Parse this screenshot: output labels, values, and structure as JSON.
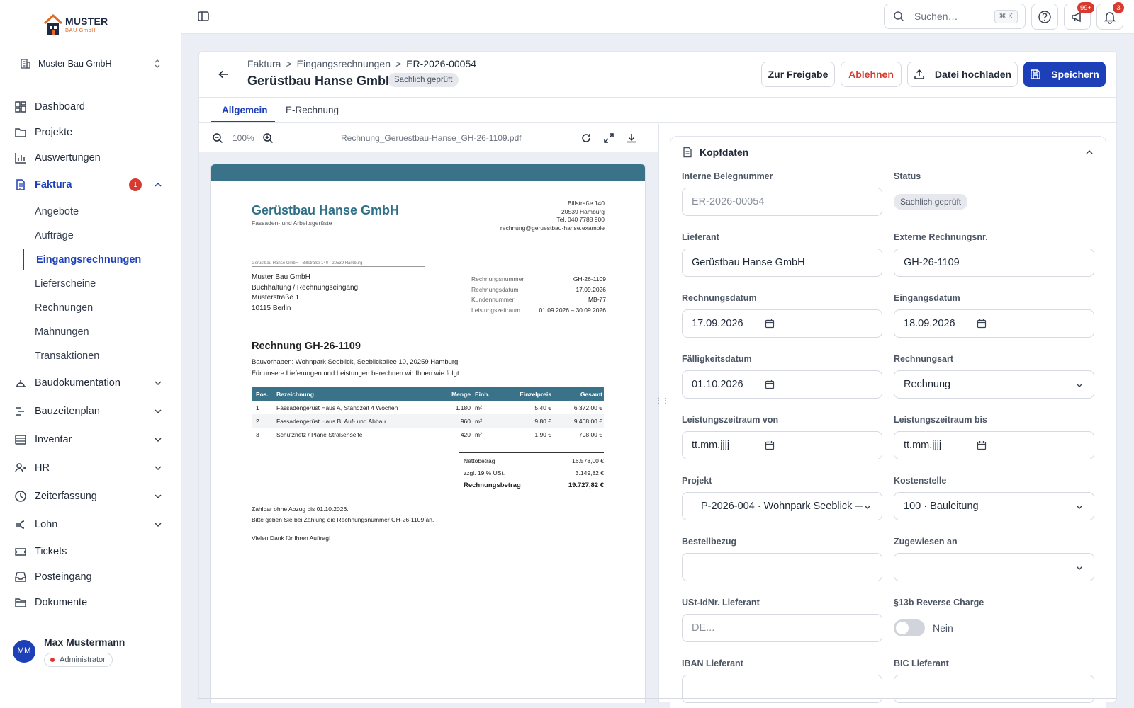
{
  "logo": {
    "line1": "MUSTER",
    "line2": "BAU GmbH"
  },
  "company_selector": {
    "name": "Muster Bau GmbH"
  },
  "sidebar": {
    "items": [
      {
        "label": "Dashboard",
        "icon": "dashboard-icon"
      },
      {
        "label": "Projekte",
        "icon": "folder-icon"
      },
      {
        "label": "Auswertungen",
        "icon": "chart-icon"
      },
      {
        "label": "Faktura",
        "icon": "document-icon",
        "badge": "1",
        "expanded": true
      },
      {
        "label": "Baudokumentation",
        "icon": "helmet-icon"
      },
      {
        "label": "Bauzeitenplan",
        "icon": "timeline-icon"
      },
      {
        "label": "Inventar",
        "icon": "inventory-icon"
      },
      {
        "label": "HR",
        "icon": "people-icon"
      },
      {
        "label": "Zeiterfassung",
        "icon": "clock-icon"
      },
      {
        "label": "Lohn",
        "icon": "euro-icon"
      },
      {
        "label": "Tickets",
        "icon": "ticket-icon"
      },
      {
        "label": "Posteingang",
        "icon": "inbox-icon"
      },
      {
        "label": "Dokumente",
        "icon": "folder-open-icon"
      }
    ],
    "faktura_sub": [
      "Angebote",
      "Aufträge",
      "Eingangsrechnungen",
      "Lieferscheine",
      "Rechnungen",
      "Mahnungen",
      "Transaktionen"
    ],
    "active_sub": "Eingangsrechnungen"
  },
  "user": {
    "initials": "MM",
    "name": "Max Mustermann",
    "role": "Administrator"
  },
  "topbar": {
    "search_placeholder": "Suchen…",
    "search_shortcut": "⌘ K",
    "announcements_badge": "99+",
    "notifications_badge": "3"
  },
  "header": {
    "breadcrumb": [
      "Faktura",
      "Eingangsrechnungen",
      "ER-2026-00054"
    ],
    "title": "Gerüstbau Hanse GmbH",
    "status": "Sachlich geprüft",
    "buttons": {
      "approve": "Zur Freigabe",
      "reject": "Ablehnen",
      "upload": "Datei hochladen",
      "save": "Speichern"
    }
  },
  "tabs": [
    {
      "label": "Allgemein",
      "active": true
    },
    {
      "label": "E-Rechnung",
      "active": false
    }
  ],
  "viewer": {
    "zoom": "100%",
    "filename": "Rechnung_Geruestbau-Hanse_GH-26-1109.pdf"
  },
  "invoice": {
    "company": "Gerüstbau Hanse GmbH",
    "tagline": "Fassaden- und Arbeitsgerüste",
    "address_lines": [
      "Billstraße 140",
      "20539 Hamburg",
      "Tel. 040 7788 900",
      "rechnung@geruestbau-hanse.example"
    ],
    "sender_line": "Gerüstbau Hanse GmbH · Billstraße 140 · 20539 Hamburg",
    "recipient": [
      "Muster Bau GmbH",
      "Buchhaltung / Rechnungseingang",
      "Musterstraße 1",
      "10115 Berlin"
    ],
    "meta": [
      {
        "label": "Rechnungsnummer",
        "value": "GH-26-1109"
      },
      {
        "label": "Rechnungsdatum",
        "value": "17.09.2026"
      },
      {
        "label": "Kundennummer",
        "value": "MB-77"
      },
      {
        "label": "Leistungszeitraum",
        "value": "01.09.2026 – 30.09.2026"
      }
    ],
    "heading": "Rechnung GH-26-1109",
    "project_line": "Bauvorhaben: Wohnpark Seeblick, Seeblickallee 10, 20259 Hamburg",
    "intro": "Für unsere Lieferungen und Leistungen berechnen wir Ihnen wie folgt:",
    "columns": [
      "Pos.",
      "Bezeichnung",
      "Menge",
      "Einh.",
      "Einzelpreis",
      "Gesamt"
    ],
    "rows": [
      {
        "pos": "1",
        "desc": "Fassadengerüst Haus A, Standzeit 4 Wochen",
        "qty": "1.180",
        "unit": "m²",
        "price": "5,40 €",
        "total": "6.372,00 €"
      },
      {
        "pos": "2",
        "desc": "Fassadengerüst Haus B, Auf- und Abbau",
        "qty": "960",
        "unit": "m²",
        "price": "9,80 €",
        "total": "9.408,00 €"
      },
      {
        "pos": "3",
        "desc": "Schutznetz / Plane Straßenseite",
        "qty": "420",
        "unit": "m²",
        "price": "1,90 €",
        "total": "798,00 €"
      }
    ],
    "totals": [
      {
        "label": "Nettobetrag",
        "value": "16.578,00 €"
      },
      {
        "label": "zzgl. 19 % USt.",
        "value": "3.149,82 €"
      },
      {
        "label": "Rechnungsbetrag",
        "value": "19.727,82 €"
      }
    ],
    "footer": [
      "Zahlbar ohne Abzug bis 01.10.2026.",
      "Bitte geben Sie bei Zahlung die Rechnungsnummer GH-26-1109 an.",
      "Vielen Dank für Ihren Auftrag!"
    ]
  },
  "form": {
    "section_title": "Kopfdaten",
    "labels": {
      "internal_no": "Interne Belegnummer",
      "status": "Status",
      "supplier": "Lieferant",
      "external_no": "Externe Rechnungsnr.",
      "invoice_date": "Rechnungsdatum",
      "receipt_date": "Eingangsdatum",
      "due_date": "Fälligkeitsdatum",
      "invoice_type": "Rechnungsart",
      "period_from": "Leistungszeitraum von",
      "period_to": "Leistungszeitraum bis",
      "project": "Projekt",
      "cost_center": "Kostenstelle",
      "order_ref": "Bestellbezug",
      "assigned": "Zugewiesen an",
      "vat_id": "USt-IdNr. Lieferant",
      "reverse_charge": "§13b Reverse Charge",
      "iban": "IBAN Lieferant",
      "bic": "BIC Lieferant"
    },
    "values": {
      "internal_no": "ER-2026-00054",
      "status": "Sachlich geprüft",
      "supplier": "Gerüstbau Hanse GmbH",
      "external_no": "GH-26-1109",
      "invoice_date": "17.09.2026",
      "receipt_date": "18.09.2026",
      "due_date": "01.10.2026",
      "invoice_type": "Rechnung",
      "period_from": "tt.mm.jjjj",
      "period_to": "tt.mm.jjjj",
      "project": "P-2026-004 · Wohnpark Seeblick —…",
      "cost_center": "100 · Bauleitung",
      "order_ref": "",
      "assigned": "",
      "vat_id_placeholder": "DE...",
      "reverse_charge": "Nein"
    }
  }
}
